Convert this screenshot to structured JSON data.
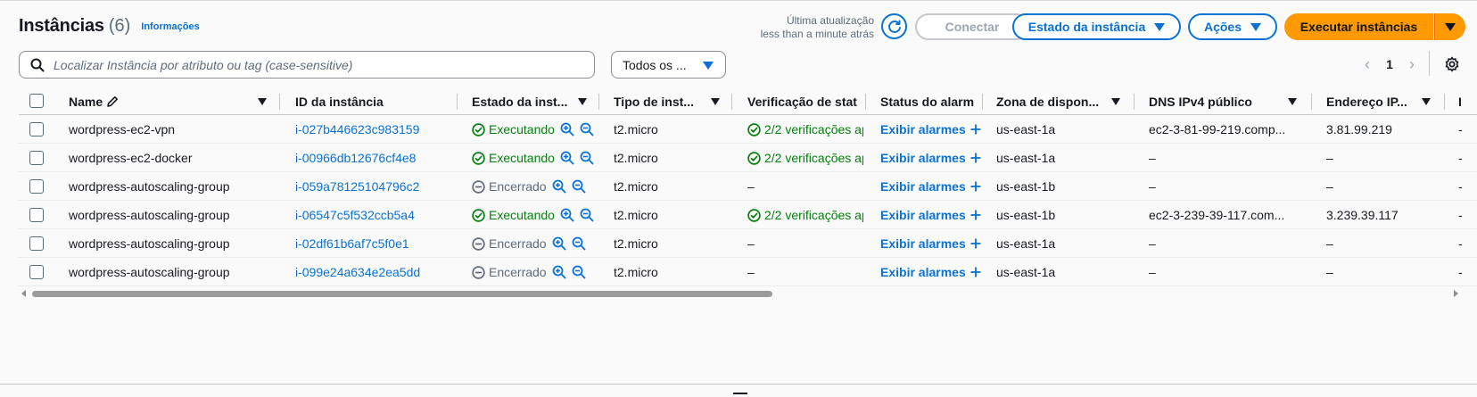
{
  "header": {
    "title": "Instâncias",
    "count": "(6)",
    "info_link": "Informações",
    "last_update_label": "Última atualização",
    "last_update_value": "less than a minute atrás"
  },
  "toolbar": {
    "connect": "Conectar",
    "instance_state": "Estado da instância",
    "actions": "Ações",
    "launch": "Executar instâncias"
  },
  "search": {
    "placeholder": "Localizar Instância por atributo ou tag (case-sensitive)"
  },
  "filter": {
    "selected": "Todos os ..."
  },
  "pagination": {
    "page": "1"
  },
  "table": {
    "columns": {
      "name": "Name",
      "id": "ID da instância",
      "state": "Estado da inst...",
      "type": "Tipo de inst...",
      "check": "Verificação de stat",
      "alarm": "Status do alarm",
      "zone": "Zona de dispon...",
      "dns": "DNS IPv4 público",
      "ip": "Endereço IP...",
      "extra": "I"
    },
    "rows": [
      {
        "name": "wordpress-ec2-vpn",
        "id": "i-027b446623c983159",
        "state": "Executando",
        "type": "t2.micro",
        "check": "2/2 verificações ap",
        "alarm": "Exibir alarmes",
        "zone": "us-east-1a",
        "dns": "ec2-3-81-99-219.comp...",
        "ip": "3.81.99.219",
        "extra": "-"
      },
      {
        "name": "wordpress-ec2-docker",
        "id": "i-00966db12676cf4e8",
        "state": "Executando",
        "type": "t2.micro",
        "check": "2/2 verificações ap",
        "alarm": "Exibir alarmes",
        "zone": "us-east-1a",
        "dns": "–",
        "ip": "–",
        "extra": "-"
      },
      {
        "name": "wordpress-autoscaling-group",
        "id": "i-059a78125104796c2",
        "state": "Encerrado",
        "type": "t2.micro",
        "check": "–",
        "alarm": "Exibir alarmes",
        "zone": "us-east-1b",
        "dns": "–",
        "ip": "–",
        "extra": "-"
      },
      {
        "name": "wordpress-autoscaling-group",
        "id": "i-06547c5f532ccb5a4",
        "state": "Executando",
        "type": "t2.micro",
        "check": "2/2 verificações ap",
        "alarm": "Exibir alarmes",
        "zone": "us-east-1b",
        "dns": "ec2-3-239-39-117.com...",
        "ip": "3.239.39.117",
        "extra": "-"
      },
      {
        "name": "wordpress-autoscaling-group",
        "id": "i-02df61b6af7c5f0e1",
        "state": "Encerrado",
        "type": "t2.micro",
        "check": "–",
        "alarm": "Exibir alarmes",
        "zone": "us-east-1a",
        "dns": "–",
        "ip": "–",
        "extra": "-"
      },
      {
        "name": "wordpress-autoscaling-group",
        "id": "i-099e24a634e2ea5dd",
        "state": "Encerrado",
        "type": "t2.micro",
        "check": "–",
        "alarm": "Exibir alarmes",
        "zone": "us-east-1a",
        "dns": "–",
        "ip": "–",
        "extra": "-"
      }
    ]
  },
  "colors": {
    "link": "#0972d3",
    "running": "#037f0c",
    "stopped": "#5f6b7a",
    "primary": "#ff9900"
  }
}
